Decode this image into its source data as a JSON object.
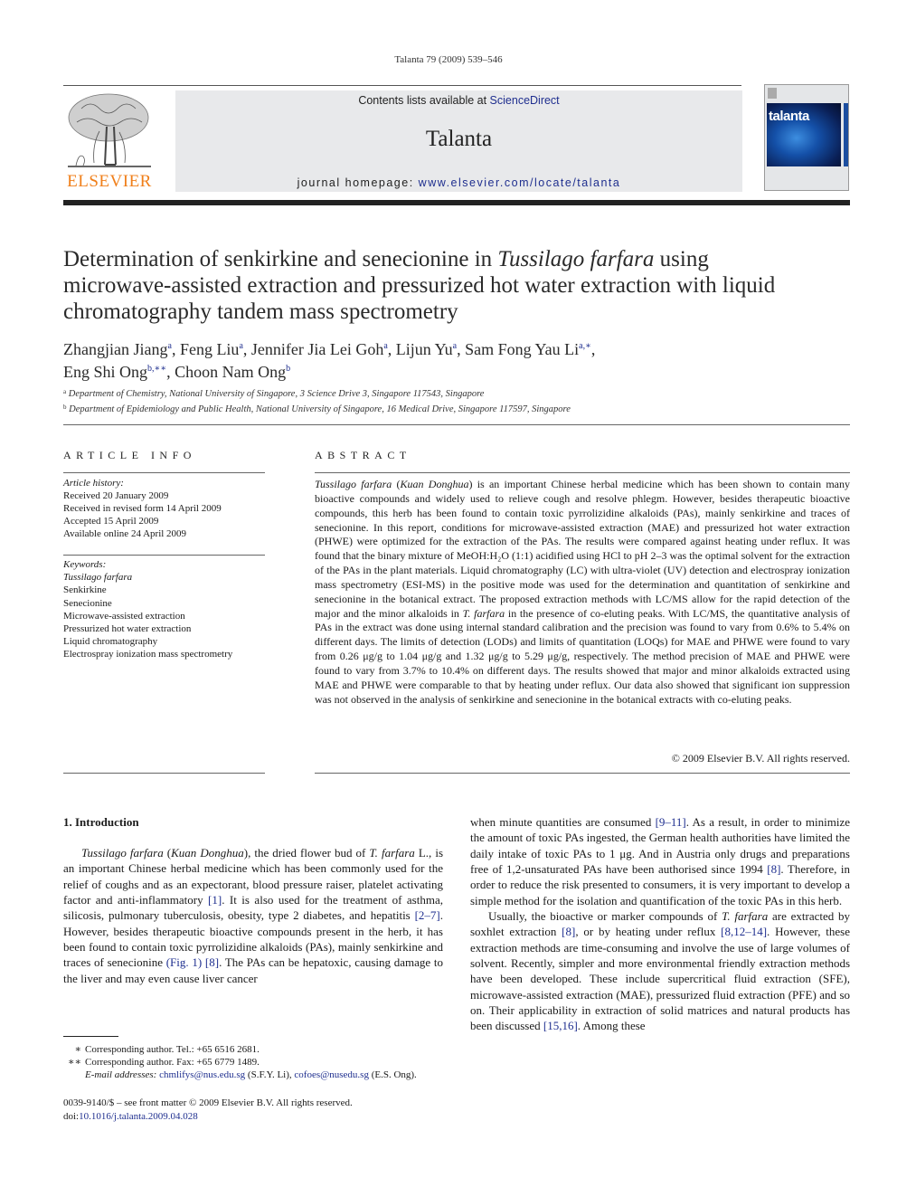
{
  "header": {
    "running_head": "Talanta 79 (2009) 539–546",
    "contents_prefix": "Contents lists available at ",
    "contents_link": "ScienceDirect",
    "journal_name": "Talanta",
    "homepage_prefix": "journal homepage: ",
    "homepage_url": "www.elsevier.com/locate/talanta",
    "publisher_logo_text": "ELSEVIER",
    "cover_title": "talanta",
    "colors": {
      "publisher_orange": "#f07f1a",
      "link_blue": "#1f2f8f",
      "masthead_gray": "#e8e9eb"
    }
  },
  "article": {
    "title_part1": "Determination of senkirkine and senecionine in ",
    "title_italic": "Tussilago farfara",
    "title_part2": " using microwave-assisted extraction and pressurized hot water extraction with liquid chromatography tandem mass spectrometry",
    "authors": [
      {
        "name": "Zhangjian Jiang",
        "aff": "a",
        "sep": ", "
      },
      {
        "name": "Feng Liu",
        "aff": "a",
        "sep": ", "
      },
      {
        "name": "Jennifer Jia Lei Goh",
        "aff": "a",
        "sep": ", "
      },
      {
        "name": "Lijun Yu",
        "aff": "a",
        "sep": ", "
      },
      {
        "name": "Sam Fong Yau Li",
        "aff": "a,∗",
        "sep": ","
      },
      {
        "name": "Eng Shi Ong",
        "aff": "b,∗∗",
        "sep": ", "
      },
      {
        "name": "Choon Nam Ong",
        "aff": "b",
        "sep": ""
      }
    ],
    "affiliations": [
      {
        "mark": "a",
        "text": "Department of Chemistry, National University of Singapore, 3 Science Drive 3, Singapore 117543, Singapore"
      },
      {
        "mark": "b",
        "text": "Department of Epidemiology and Public Health, National University of Singapore, 16 Medical Drive, Singapore 117597, Singapore"
      }
    ]
  },
  "article_info": {
    "heading": "ARTICLE INFO",
    "history_label": "Article history:",
    "history": [
      "Received 20 January 2009",
      "Received in revised form 14 April 2009",
      "Accepted 15 April 2009",
      "Available online 24 April 2009"
    ],
    "keywords_label": "Keywords:",
    "keywords": [
      "Tussilago farfara",
      "Senkirkine",
      "Senecionine",
      "Microwave-assisted extraction",
      "Pressurized hot water extraction",
      "Liquid chromatography",
      "Electrospray ionization mass spectrometry"
    ]
  },
  "abstract": {
    "heading": "ABSTRACT",
    "lead_italic": "Tussilago farfara",
    "lead_paren_italic": "Kuan Donghua",
    "text_1": " is an important Chinese herbal medicine which has been shown to contain many bioactive compounds and widely used to relieve cough and resolve phlegm. However, besides therapeutic bioactive compounds, this herb has been found to contain toxic pyrrolizidine alkaloids (PAs), mainly senkirkine and traces of senecionine. In this report, conditions for microwave-assisted extraction (MAE) and pressurized hot water extraction (PHWE) were optimized for the extraction of the PAs. The results were compared against heating under reflux. It was found that the binary mixture of MeOH:H₂O (1:1) acidified using HCl to pH 2–3 was the optimal solvent for the extraction of the PAs in the plant materials. Liquid chromatography (LC) with ultra-violet (UV) detection and electrospray ionization mass spectrometry (ESI-MS) in the positive mode was used for the determination and quantitation of senkirkine and senecionine in the botanical extract. The proposed extraction methods with LC/MS allow for the rapid detection of the major and the minor alkaloids in ",
    "species_italic": "T. farfara",
    "text_2": " in the presence of co-eluting peaks. With LC/MS, the quantitative analysis of PAs in the extract was done using internal standard calibration and the precision was found to vary from 0.6% to 5.4% on different days. The limits of detection (LODs) and limits of quantitation (LOQs) for MAE and PHWE were found to vary from 0.26 μg/g to 1.04 μg/g and 1.32 μg/g to 5.29 μg/g, respectively. The method precision of MAE and PHWE were found to vary from 3.7% to 10.4% on different days. The results showed that major and minor alkaloids extracted using MAE and PHWE were comparable to that by heating under reflux. Our data also showed that significant ion suppression was not observed in the analysis of senkirkine and senecionine in the botanical extracts with co-eluting peaks.",
    "copyright": "© 2009 Elsevier B.V. All rights reserved."
  },
  "introduction": {
    "heading": "1.  Introduction",
    "p1": [
      {
        "t": "Tussilago farfara",
        "i": true
      },
      {
        "t": " ("
      },
      {
        "t": "Kuan Donghua",
        "i": true
      },
      {
        "t": "), the dried flower bud of "
      },
      {
        "t": "T. farfara",
        "i": true
      },
      {
        "t": " L., is an important Chinese herbal medicine which has been commonly used for the relief of coughs and as an expectorant, blood pressure raiser, platelet activating factor and anti-inflammatory "
      },
      {
        "t": "[1]",
        "ref": true
      },
      {
        "t": ". It is also used for the treatment of asthma, silicosis, pulmonary tuberculosis, obesity, type 2 diabetes, and hepatitis "
      },
      {
        "t": "[2–7]",
        "ref": true
      },
      {
        "t": ". However, besides therapeutic bioactive compounds present in the herb, it has been found to contain toxic pyrrolizidine alkaloids (PAs), mainly senkirkine and traces of senecionine "
      },
      {
        "t": "(Fig. 1)",
        "ref": true
      },
      {
        "t": " "
      },
      {
        "t": "[8]",
        "ref": true
      },
      {
        "t": ". The PAs can be hepatoxic, causing damage to the liver and may even cause liver cancer when minute quantities are consumed "
      },
      {
        "t": "[9–11]",
        "ref": true
      },
      {
        "t": ". As a result, in order to minimize the amount of toxic PAs ingested, the German health authorities have limited the daily intake of toxic PAs to 1 μg. And in Austria only drugs and preparations free of 1,2-unsaturated PAs have been authorised since 1994 "
      },
      {
        "t": "[8]",
        "ref": true
      },
      {
        "t": ". Therefore, in order to reduce the risk presented to consumers, it is very important to develop a simple method for the isolation and quantification of the toxic PAs in this herb."
      }
    ],
    "p2": [
      {
        "t": "Usually, the bioactive or marker compounds of "
      },
      {
        "t": "T. farfara",
        "i": true
      },
      {
        "t": " are extracted by soxhlet extraction "
      },
      {
        "t": "[8]",
        "ref": true
      },
      {
        "t": ", or by heating under reflux "
      },
      {
        "t": "[8,12–14]",
        "ref": true
      },
      {
        "t": ". However, these extraction methods are time-consuming and involve the use of large volumes of solvent. Recently, simpler and more environmental friendly extraction methods have been developed. These include supercritical fluid extraction (SFE), microwave-assisted extraction (MAE), pressurized fluid extraction (PFE) and so on. Their applicability in extraction of solid matrices and natural products has been discussed "
      },
      {
        "t": "[15,16]",
        "ref": true
      },
      {
        "t": ". Among these"
      }
    ]
  },
  "footnotes": {
    "items": [
      {
        "mark": "∗",
        "text": "Corresponding author. Tel.: +65 6516 2681."
      },
      {
        "mark": "∗∗",
        "text": "Corresponding author. Fax: +65 6779 1489."
      }
    ],
    "email_label": "E-mail addresses:",
    "emails": [
      {
        "address": "chmlifys@nus.edu.sg",
        "who": " (S.F.Y. Li), "
      },
      {
        "address": "cofoes@nusedu.sg",
        "who": " (E.S. Ong)."
      }
    ],
    "issn_line": "0039-9140/$ – see front matter © 2009 Elsevier B.V. All rights reserved.",
    "doi_label": "doi:",
    "doi": "10.1016/j.talanta.2009.04.028"
  }
}
